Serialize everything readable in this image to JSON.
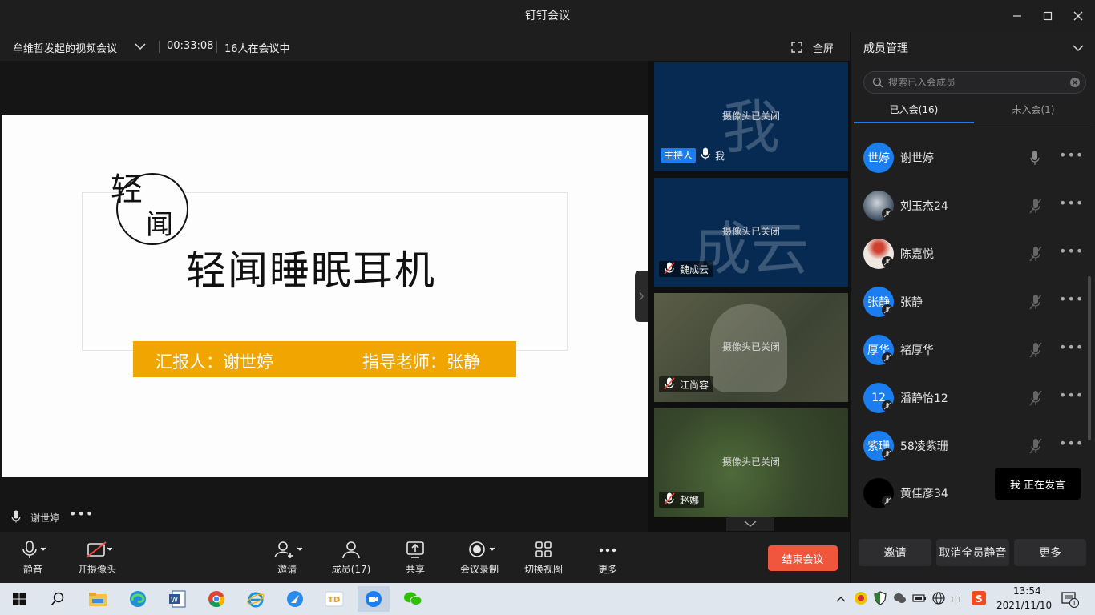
{
  "window": {
    "title": "钉钉会议"
  },
  "meeting": {
    "title": "牟维哲发起的视频会议",
    "elapsed": "00:33:08",
    "participants_text": "16人在会议中",
    "fullscreen_label": "全屏"
  },
  "slide": {
    "logo_char1": "轻",
    "logo_char2": "闻",
    "title": "轻闻睡眠耳机",
    "reporter": "汇报人：谢世婷",
    "advisor": "指导老师：张静"
  },
  "share_footer": {
    "sharer": "谢世婷",
    "more": "•••"
  },
  "tiles": [
    {
      "big": "我",
      "status": "摄像头已关闭",
      "host_badge": "主持人",
      "name": "我"
    },
    {
      "big": "成云",
      "status": "摄像头已关闭",
      "name": "魏成云"
    },
    {
      "big": "",
      "status": "摄像头已关闭",
      "name": "江尚容"
    },
    {
      "big": "",
      "status": "摄像头已关闭",
      "name": "赵娜"
    }
  ],
  "panel": {
    "title": "成员管理",
    "search_placeholder": "搜索已入会成员",
    "tab_joined": "已入会(16)",
    "tab_not_joined": "未入会(1)",
    "members": [
      {
        "avatar_text": "世婷",
        "name": "谢世婷",
        "color": "#1a7ef0"
      },
      {
        "avatar_text": "",
        "name": "刘玉杰24",
        "color": "#2a3a4a"
      },
      {
        "avatar_text": "",
        "name": "陈嘉悦",
        "color": "#e8d8d0"
      },
      {
        "avatar_text": "张静",
        "name": "张静",
        "color": "#1a7ef0"
      },
      {
        "avatar_text": "厚华",
        "name": "褚厚华",
        "color": "#1a7ef0"
      },
      {
        "avatar_text": "12",
        "name": "潘静怡12",
        "color": "#1a7ef0"
      },
      {
        "avatar_text": "紫珊",
        "name": "58凌紫珊",
        "color": "#1a7ef0"
      },
      {
        "avatar_text": "",
        "name": "黄佳彦34",
        "color": "#000000"
      }
    ],
    "speaking_toast": "我  正在发言",
    "btn_invite": "邀请",
    "btn_unmute_all": "取消全员静音",
    "btn_more": "更多"
  },
  "toolbar": {
    "mute": "静音",
    "camera": "开摄像头",
    "invite": "邀请",
    "members": "成员(17)",
    "share": "共享",
    "record": "会议录制",
    "switch_view": "切换视图",
    "more": "更多",
    "end": "结束会议"
  },
  "taskbar": {
    "time": "13:54",
    "date": "2021/11/10",
    "ime": "中"
  },
  "colors": {
    "accent": "#1a7ef0",
    "end_button": "#f0563c",
    "slide_band": "#f0a500"
  }
}
